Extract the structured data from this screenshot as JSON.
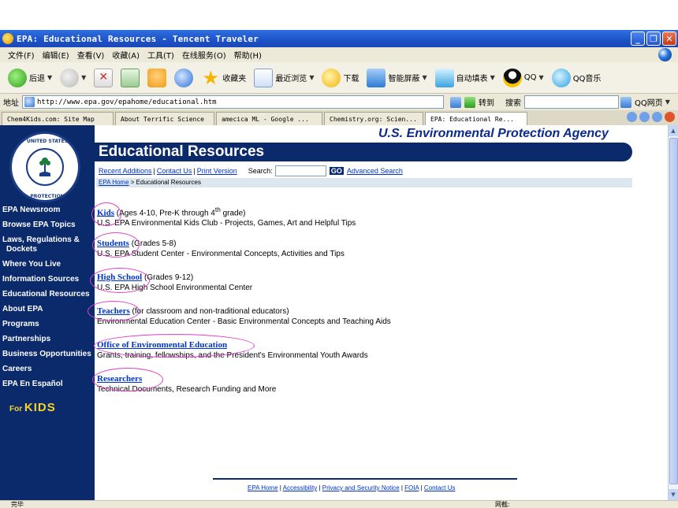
{
  "window": {
    "title": "EPA: Educational Resources - Tencent Traveler",
    "controls": [
      "_",
      "❐",
      "✕"
    ]
  },
  "menu": [
    "文件(F)",
    "编辑(E)",
    "查看(V)",
    "收藏(A)",
    "工具(T)",
    "在线服务(O)",
    "帮助(H)"
  ],
  "toolbar": {
    "back": "后退",
    "favorites": "收藏夹",
    "recent": "最近浏览",
    "download": "下载",
    "smart_block": "智能屏蔽",
    "autofill": "自动填表",
    "qq": "QQ",
    "qq_music": "QQ音乐"
  },
  "addressbar": {
    "label": "地址",
    "url": "http://www.epa.gov/epahome/educational.htm",
    "go_label": "转到",
    "search_label": "搜索",
    "qq_web": "QQ网页"
  },
  "tabs": [
    {
      "label": "Chem4Kids.com: Site Map",
      "active": false
    },
    {
      "label": "About Terrific Science",
      "active": false
    },
    {
      "label": "amecica ML - Google ...",
      "active": false
    },
    {
      "label": "Chemistry.org: Scien...",
      "active": false
    },
    {
      "label": "EPA: Educational Re...",
      "active": true
    }
  ],
  "sidebar": {
    "seal_top": "UNITED STATES",
    "seal_bottom": "PROTECTION",
    "items": [
      "EPA Newsroom",
      "Browse EPA Topics",
      "Laws, Regulations &",
      "Dockets",
      "Where You Live",
      "Information Sources",
      "Educational Resources",
      "About EPA",
      "Programs",
      "Partnerships",
      "Business Opportunities",
      "Careers",
      "EPA En Español"
    ],
    "for_kids_prefix": "For",
    "for_kids": "KIDS"
  },
  "page": {
    "agency": "U.S. Environmental Protection Agency",
    "title": "Educational Resources",
    "links": {
      "recent": "Recent Additions",
      "contact": "Contact Us",
      "print": "Print Version",
      "search_label": "Search:",
      "go": "GO",
      "advanced": "Advanced Search"
    },
    "breadcrumb_home": "EPA Home",
    "breadcrumb_current": "> Educational Resources"
  },
  "resources": [
    {
      "link": "Kids",
      "desc_a": "(Ages 4-10, Pre-K through 4",
      "sup": "th",
      "desc_b": " grade)",
      "detail": "U.S. EPA Environmental Kids Club - Projects, Games, Art and Helpful Tips"
    },
    {
      "link": "Students",
      "desc_a": "(Grades 5-8)",
      "sup": "",
      "desc_b": "",
      "detail": "U.S. EPA Student Center - Environmental Concepts, Activities and Tips"
    },
    {
      "link": "High School",
      "desc_a": "(Grades 9-12)",
      "sup": "",
      "desc_b": "",
      "detail": "U.S. EPA High School Environmental Center"
    },
    {
      "link": "Teachers",
      "desc_a": "(for classroom and non-traditional educators)",
      "sup": "",
      "desc_b": "",
      "detail": "Environmental Education Center - Basic Environmental Concepts and Teaching Aids"
    },
    {
      "link": "Office of Environmental Education",
      "desc_a": "",
      "sup": "",
      "desc_b": "",
      "detail": "Grants, training, fellowships, and the President's Environmental Youth Awards"
    },
    {
      "link": "Researchers",
      "desc_a": "",
      "sup": "",
      "desc_b": "",
      "detail": "Technical Documents, Research Funding and More"
    }
  ],
  "footer": [
    "EPA Home",
    "Accessibility",
    "Privacy and Security Notice",
    "FOIA",
    "Contact Us"
  ],
  "status": {
    "left": "完毕",
    "right": "网截:"
  },
  "colors": {
    "epa_navy": "#0b2a6c",
    "link": "#0033cc",
    "annotation": "#e040c8"
  }
}
